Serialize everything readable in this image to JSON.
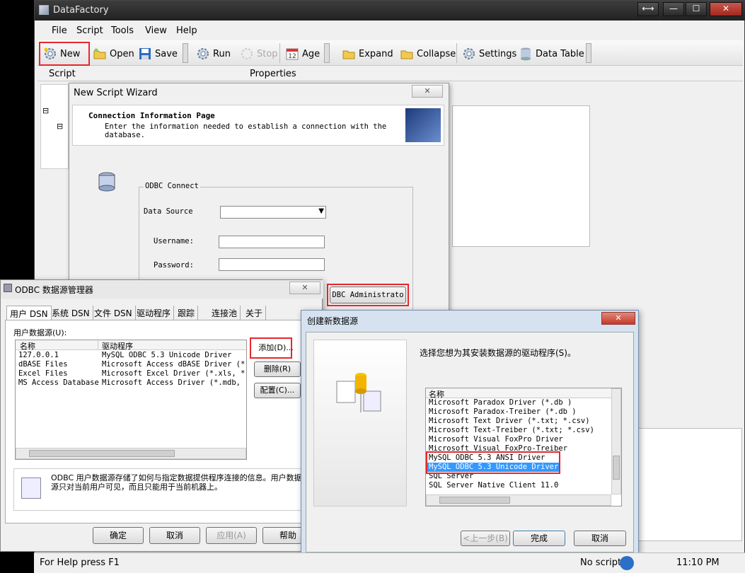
{
  "app": {
    "title": "DataFactory"
  },
  "window_controls": {
    "resize": "⟷",
    "minimize": "—",
    "maximize": "☐",
    "close": "✕"
  },
  "menus": [
    "File",
    "Script",
    "Tools",
    "View",
    "Help"
  ],
  "toolbar": {
    "new": "New",
    "open": "Open",
    "save": "Save",
    "run": "Run",
    "stop": "Stop",
    "age": "Age",
    "expand": "Expand",
    "collapse": "Collapse",
    "settings": "Settings",
    "data_table": "Data Table"
  },
  "panels": {
    "script": "Script",
    "properties": "Properties"
  },
  "wizard": {
    "title": "New Script Wizard",
    "close": "✕",
    "page_title": "Connection Information Page",
    "page_desc": "Enter the information needed to establish a connection with the database.",
    "group": "ODBC Connect",
    "data_source_label": "Data Source",
    "username_label": "Username:",
    "password_label": "Password:",
    "odbc_admin_button": "DBC Administrato"
  },
  "odbc": {
    "title": "ODBC 数据源管理器",
    "close": "✕",
    "tabs": [
      "用户 DSN",
      "系统 DSN",
      "文件 DSN",
      "驱动程序",
      "跟踪",
      "连接池",
      "关于"
    ],
    "list_label": "用户数据源(U):",
    "columns": [
      "名称",
      "驱动程序"
    ],
    "rows": [
      {
        "name": "127.0.0.1",
        "driver": "MySQL ODBC 5.3 Unicode Driver"
      },
      {
        "name": "dBASE Files",
        "driver": "Microsoft Access dBASE Driver (*.d"
      },
      {
        "name": "Excel Files",
        "driver": "Microsoft Excel Driver (*.xls, *.x"
      },
      {
        "name": "MS Access Database",
        "driver": "Microsoft Access Driver (*.mdb, *."
      }
    ],
    "add": "添加(D)...",
    "remove": "删除(R)",
    "configure": "配置(C)...",
    "info": "ODBC 用户数据源存储了如何与指定数据提供程序连接的信息。用户数据源只对当前用户可见，而且只能用于当前机器上。",
    "ok": "确定",
    "cancel": "取消",
    "apply": "应用(A)",
    "help": "帮助"
  },
  "newsrc": {
    "title": "创建新数据源",
    "close": "✕",
    "prompt": "选择您想为其安装数据源的驱动程序(S)。",
    "column": "名称",
    "drivers": [
      "Microsoft Paradox Driver (*.db )",
      "Microsoft Paradox-Treiber (*.db )",
      "Microsoft Text Driver (*.txt; *.csv)",
      "Microsoft Text-Treiber (*.txt; *.csv)",
      "Microsoft Visual FoxPro Driver",
      "Microsoft Visual FoxPro-Treiber",
      "MySQL ODBC 5.3 ANSI Driver",
      "MySQL ODBC 5.3 Unicode Driver",
      "SQL Server",
      "SQL Server Native Client 11.0"
    ],
    "selected_driver": "MySQL ODBC 5.3 Unicode Driver",
    "back": "<上一步(B)",
    "finish": "完成",
    "cancel": "取消"
  },
  "status": {
    "help": "For Help press F1",
    "script": "No script",
    "time": "11:10 PM"
  },
  "colors": {
    "highlight_red": "#e8262c",
    "selection_blue": "#3399ff"
  }
}
